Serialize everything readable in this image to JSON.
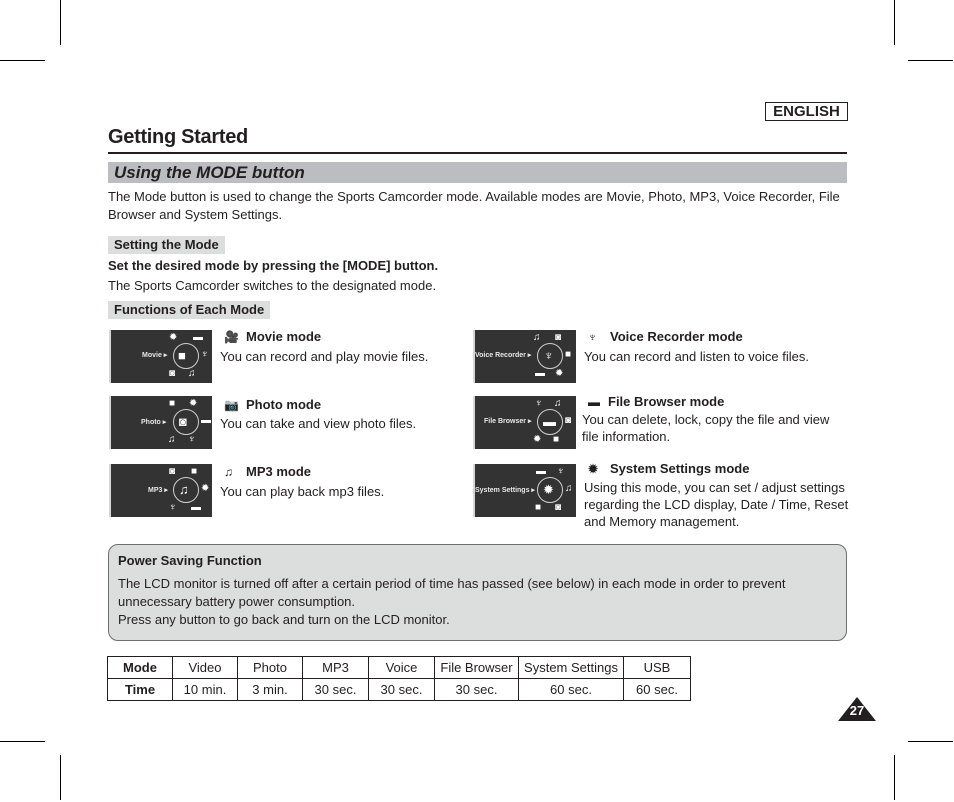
{
  "language_badge": "ENGLISH",
  "page_title": "Getting Started",
  "section_title": "Using the MODE button",
  "intro_text": "The Mode button is used to change the Sports Camcorder mode. Available modes are Movie, Photo, MP3, Voice Recorder, File Browser and System Settings.",
  "setting_mode": {
    "heading": "Setting the Mode",
    "instruction": "Set the desired mode by pressing the [MODE] button.",
    "result": "The Sports Camcorder switches to the designated mode."
  },
  "functions_heading": "Functions of Each Mode",
  "modes": [
    {
      "lcd_label": "Movie ▸",
      "icon": "movie-camera-icon",
      "title": "Movie mode",
      "description": "You can record and play movie files."
    },
    {
      "lcd_label": "Photo ▸",
      "icon": "camera-icon",
      "title": "Photo mode",
      "description": "You can take and view photo files."
    },
    {
      "lcd_label": "MP3 ▸",
      "icon": "music-note-icon",
      "title": "MP3 mode",
      "description": "You can play back mp3 files."
    },
    {
      "lcd_label": "Voice Recorder ▸",
      "icon": "microphone-icon",
      "title": "Voice Recorder mode",
      "description": "You can record and listen to voice files."
    },
    {
      "lcd_label": "File Browser ▸",
      "icon": "folder-icon",
      "title": "File Browser mode",
      "description": "You can delete, lock, copy the file and view file information."
    },
    {
      "lcd_label": "System Settings ▸",
      "icon": "gear-icon",
      "title": "System Settings mode",
      "description": "Using this mode, you can set / adjust settings regarding the LCD display, Date / Time, Reset and Memory management."
    }
  ],
  "power_saving": {
    "title": "Power Saving Function",
    "line1": "The LCD monitor is turned off after a certain period of time has passed (see below) in each mode in order to prevent unnecessary battery power consumption.",
    "line2": "Press any button to go back and turn on the LCD monitor."
  },
  "timeout_table": {
    "row_headers": [
      "Mode",
      "Time"
    ],
    "modes": [
      "Video",
      "Photo",
      "MP3",
      "Voice",
      "File Browser",
      "System Settings",
      "USB"
    ],
    "times": [
      "10 min.",
      "3 min.",
      "30 sec.",
      "30 sec.",
      "30 sec.",
      "60 sec.",
      "60 sec."
    ]
  },
  "page_number": "27"
}
